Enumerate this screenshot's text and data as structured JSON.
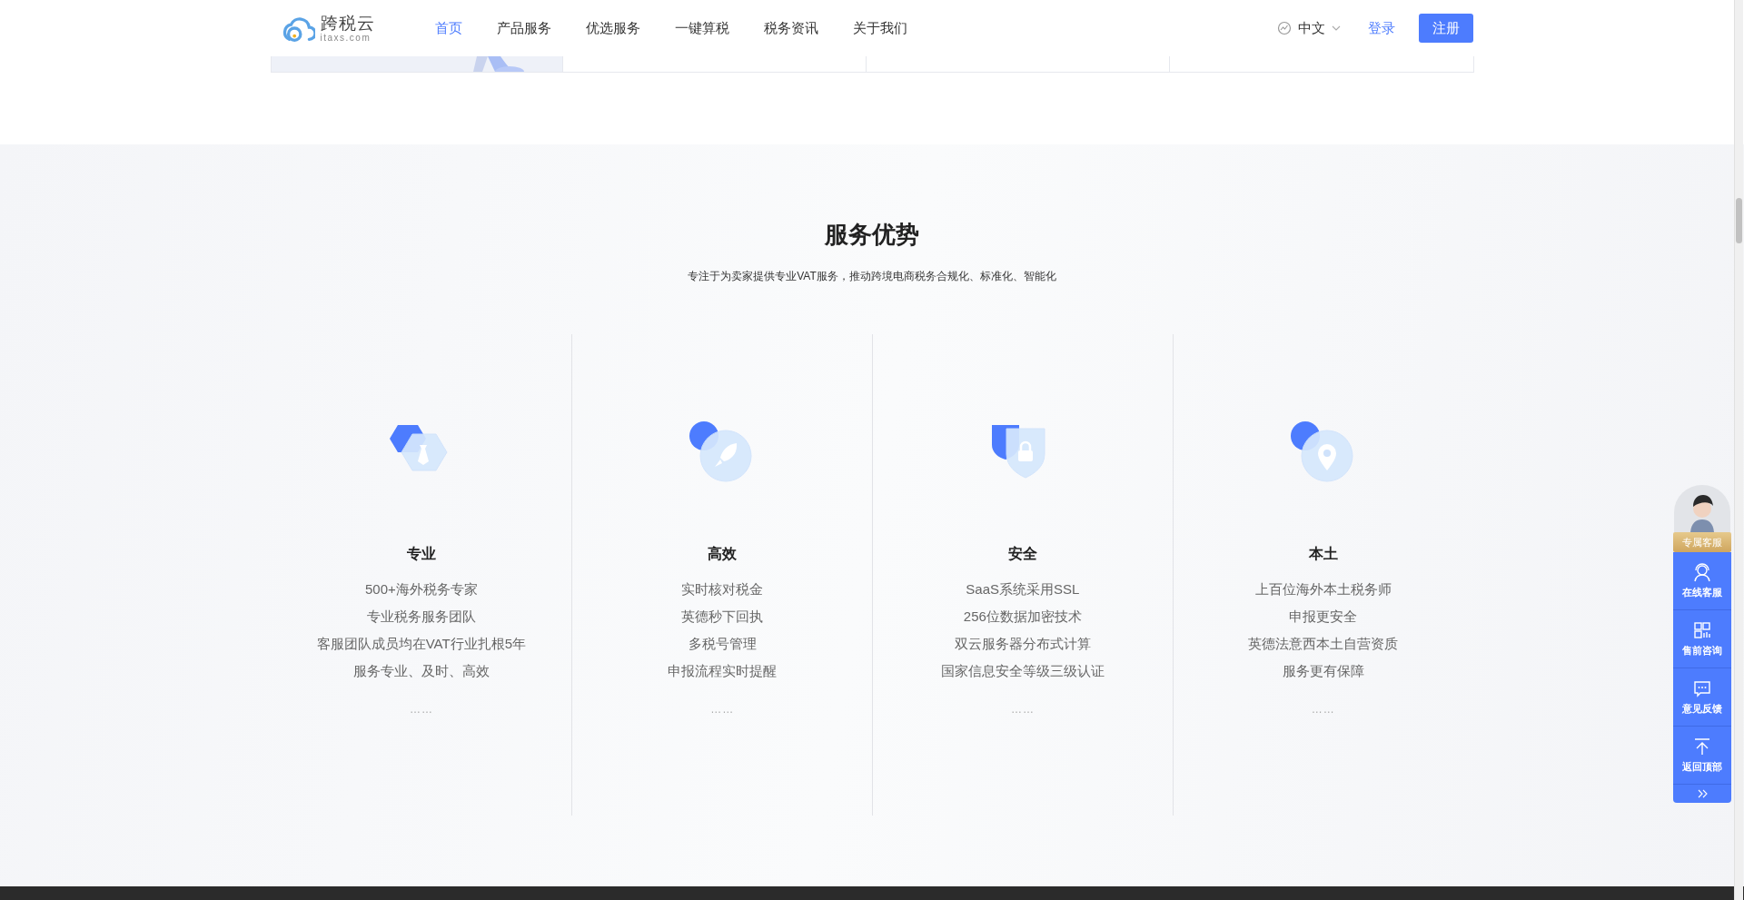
{
  "header": {
    "logo": {
      "name": "跨税云",
      "domain": "itaxs.com"
    },
    "nav": [
      {
        "label": "首页",
        "selected": true
      },
      {
        "label": "产品服务",
        "selected": false
      },
      {
        "label": "优选服务",
        "selected": false
      },
      {
        "label": "一键算税",
        "selected": false
      },
      {
        "label": "税务资讯",
        "selected": false
      },
      {
        "label": "关于我们",
        "selected": false
      }
    ],
    "language": "中文",
    "login": "登录",
    "register": "注册"
  },
  "top_cards": [
    {
      "kind": "picture"
    },
    {
      "kind": "empty"
    },
    {
      "kind": "empty"
    },
    {
      "kind": "empty"
    }
  ],
  "section": {
    "title": "服务优势",
    "subtitle": "专注于为卖家提供专业VAT服务，推动跨境电商税务合规化、标准化、智能化",
    "features": [
      {
        "kind": "tie",
        "title": "专业",
        "lines": [
          "500+海外税务专家",
          "专业税务服务团队",
          "客服团队成员均在VAT行业扎根5年",
          "服务专业、及时、高效"
        ],
        "more": "……"
      },
      {
        "kind": "rocket",
        "title": "高效",
        "lines": [
          "实时核对税金",
          "英德秒下回执",
          "多税号管理",
          "申报流程实时提醒"
        ],
        "more": "……"
      },
      {
        "kind": "lock",
        "title": "安全",
        "lines": [
          "SaaS系统采用SSL",
          "256位数据加密技术",
          "双云服务器分布式计算",
          "国家信息安全等级三级认证"
        ],
        "more": "……"
      },
      {
        "kind": "pin",
        "title": "本土",
        "lines": [
          "上百位海外本土税务师",
          "申报更安全",
          "英德法意西本土自营资质",
          "服务更有保障"
        ],
        "more": "……"
      }
    ]
  },
  "side_widget": {
    "label": "专属客服",
    "items": [
      {
        "kind": "headset",
        "label": "在线客服"
      },
      {
        "kind": "qr",
        "label": "售前咨询"
      },
      {
        "kind": "chat",
        "label": "意见反馈"
      },
      {
        "kind": "top",
        "label": "返回顶部"
      }
    ]
  }
}
